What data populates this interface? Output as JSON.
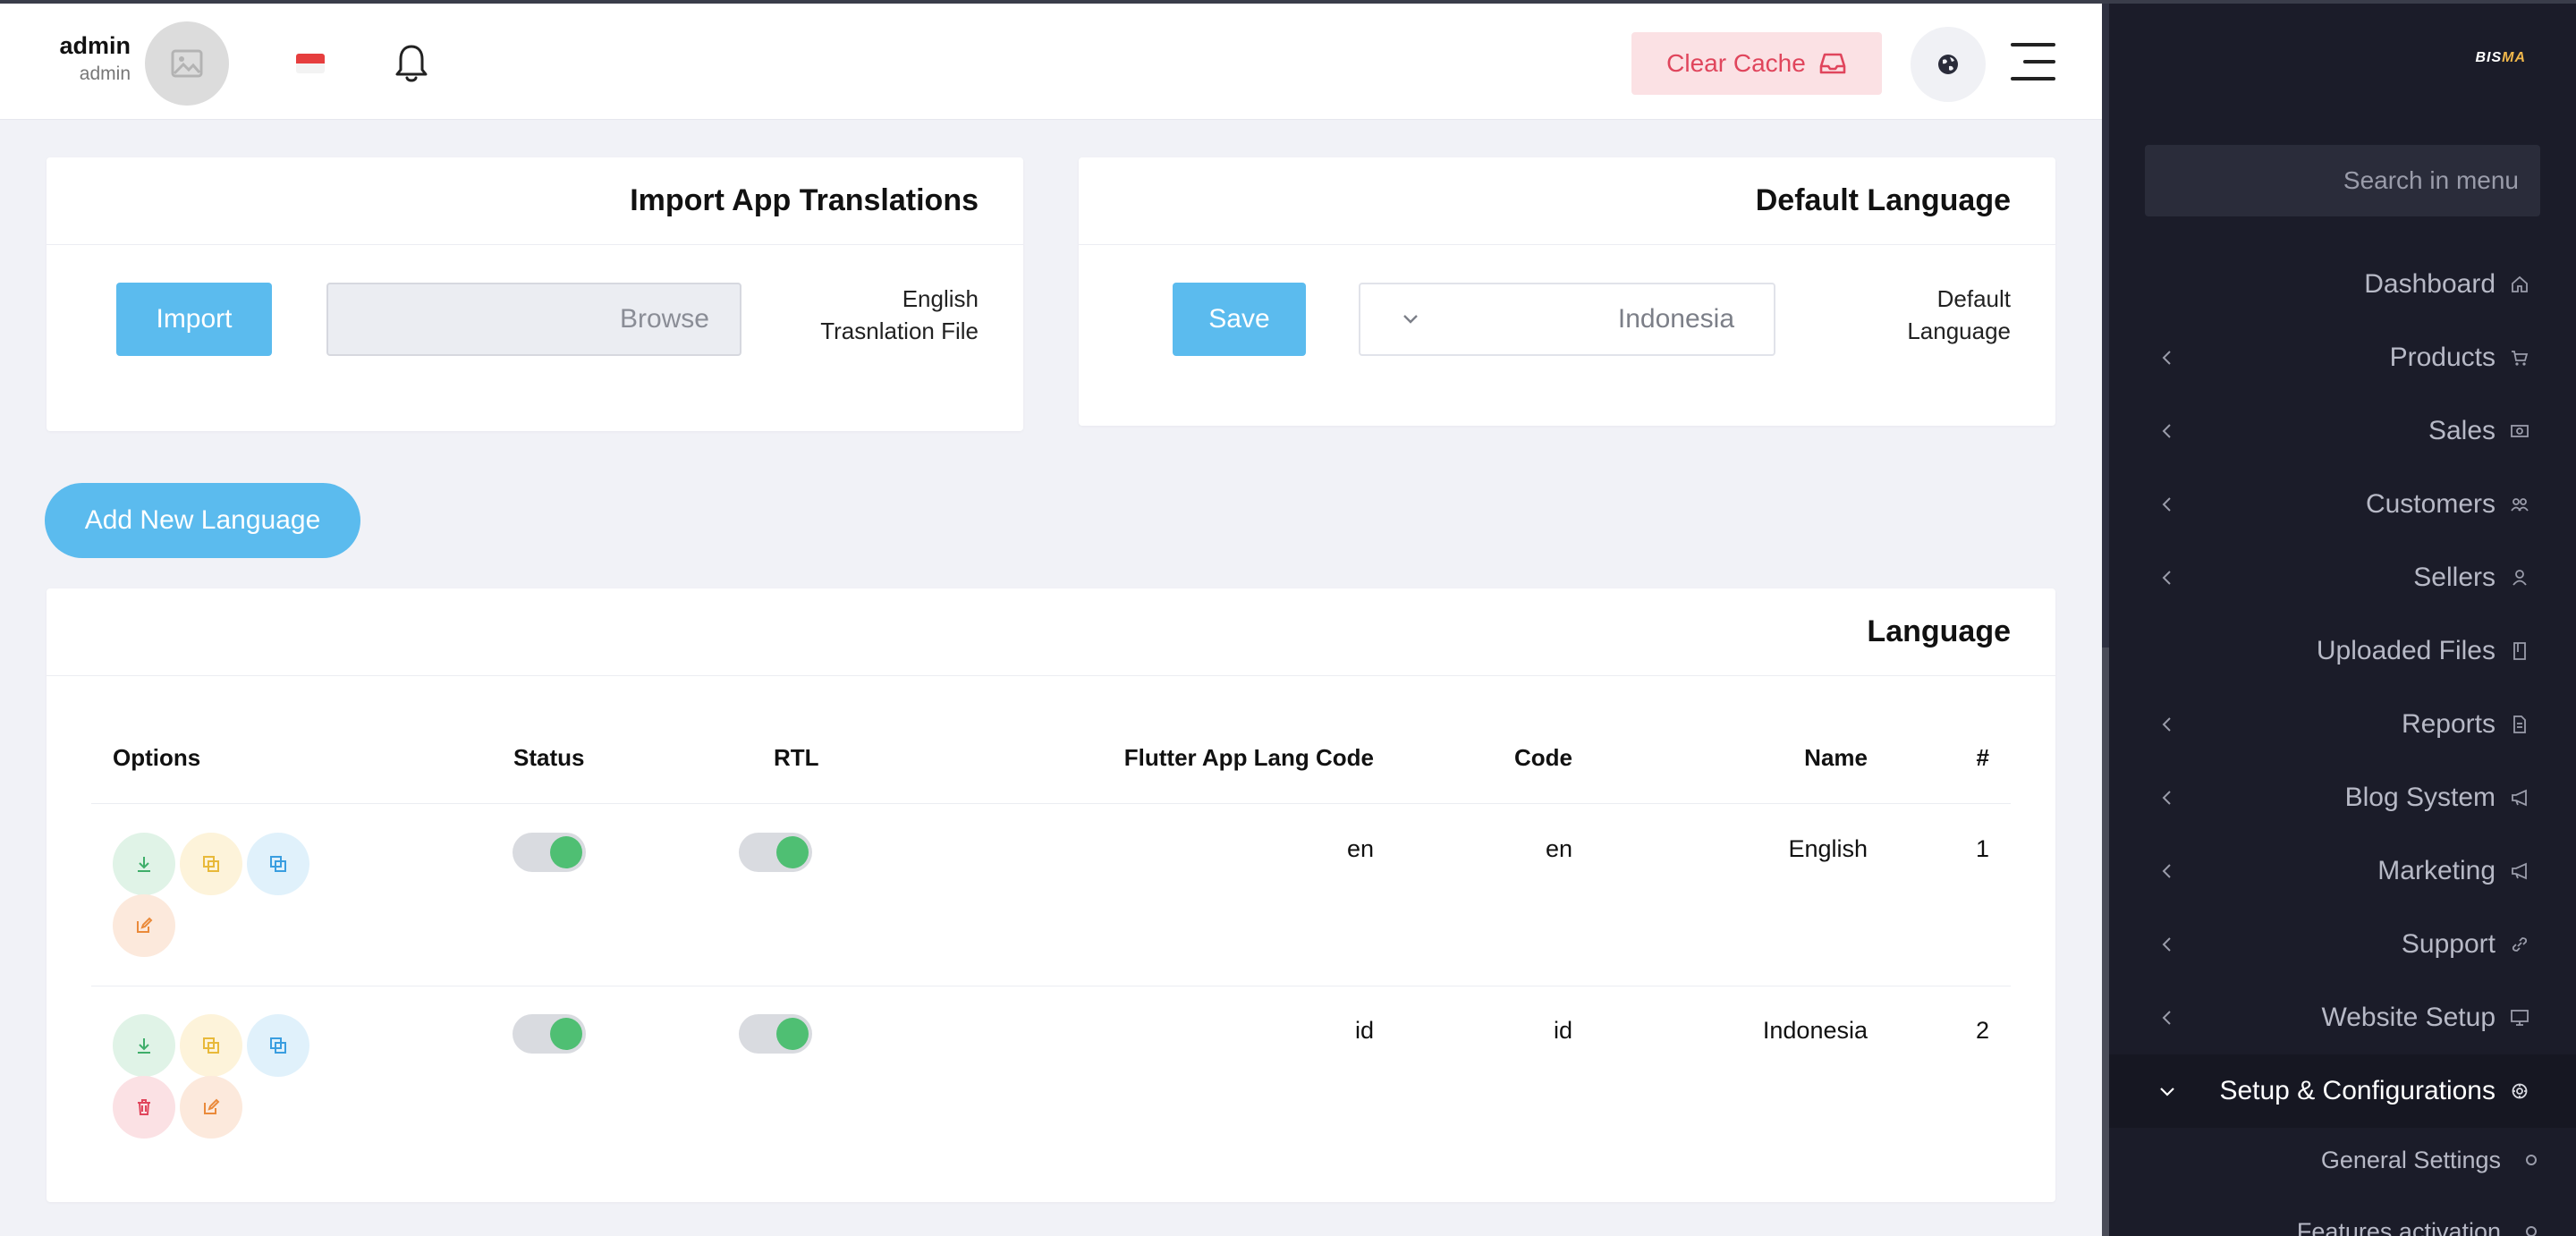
{
  "header": {
    "user_name": "admin",
    "user_role": "admin",
    "clear_cache_label": "Clear Cache"
  },
  "import_card": {
    "title": "Import App Translations",
    "button_label": "Import",
    "file_placeholder": "Browse",
    "label_line1": "English",
    "label_line2": "Trasnlation File"
  },
  "default_lang_card": {
    "title": "Default Language",
    "button_label": "Save",
    "selected_value": "Indonesia",
    "label_line1": "Default",
    "label_line2": "Language"
  },
  "add_language_label": "Add New Language",
  "language_table": {
    "title": "Language",
    "columns": {
      "options": "Options",
      "status": "Status",
      "rtl": "RTL",
      "flutter_code": "Flutter App Lang Code",
      "code": "Code",
      "name": "Name",
      "index": "#"
    },
    "rows": [
      {
        "index": "1",
        "name": "English",
        "code": "en",
        "flutter_code": "en",
        "rtl": true,
        "status": true
      },
      {
        "index": "2",
        "name": "Indonesia",
        "code": "id",
        "flutter_code": "id",
        "rtl": true,
        "status": true
      }
    ]
  },
  "sidebar": {
    "logo_main": "BIS",
    "logo_accent": "MA",
    "search_placeholder": "Search in menu",
    "items": [
      {
        "label": "Dashboard",
        "icon": "home-icon",
        "expandable": false
      },
      {
        "label": "Products",
        "icon": "cart-icon",
        "expandable": true
      },
      {
        "label": "Sales",
        "icon": "money-icon",
        "expandable": true
      },
      {
        "label": "Customers",
        "icon": "users-icon",
        "expandable": true
      },
      {
        "label": "Sellers",
        "icon": "user-icon",
        "expandable": true
      },
      {
        "label": "Uploaded Files",
        "icon": "folder-icon",
        "expandable": false
      },
      {
        "label": "Reports",
        "icon": "file-icon",
        "expandable": true
      },
      {
        "label": "Blog System",
        "icon": "megaphone-icon",
        "expandable": true
      },
      {
        "label": "Marketing",
        "icon": "megaphone-icon",
        "expandable": true
      },
      {
        "label": "Support",
        "icon": "link-icon",
        "expandable": true
      },
      {
        "label": "Website Setup",
        "icon": "monitor-icon",
        "expandable": true
      },
      {
        "label": "Setup & Configurations",
        "icon": "gear-icon",
        "expandable": true,
        "active": true
      }
    ],
    "sub_items": [
      {
        "label": "General Settings"
      },
      {
        "label": "Features activation"
      }
    ],
    "colors": {
      "bg": "#1b1c29",
      "text": "#b7b9c6",
      "active_text": "#ffffff"
    }
  },
  "colors": {
    "accent_blue": "#5bbbee",
    "toggle_on": "#4fbf73",
    "danger_bg": "#fbe1e4",
    "danger_text": "#e0455c"
  }
}
